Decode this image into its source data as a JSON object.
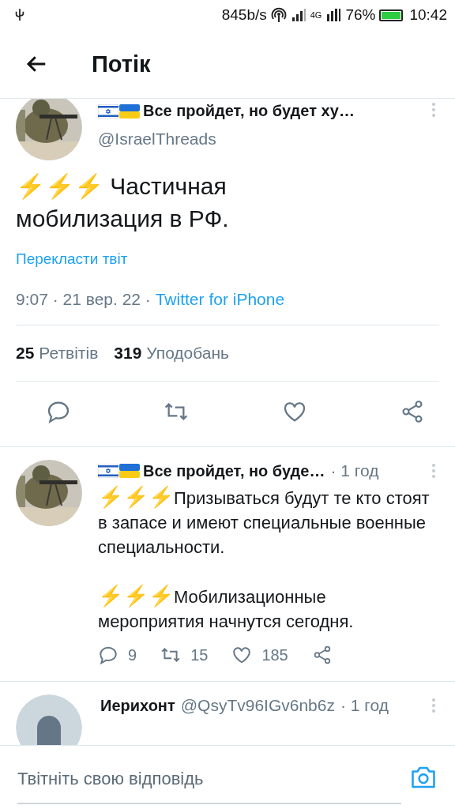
{
  "status_bar": {
    "speed": "845b/s",
    "network": "4G",
    "battery": "76%",
    "time": "10:42"
  },
  "header": {
    "title": "Потік"
  },
  "tweet": {
    "name": "Все пройдет, но будет ху…",
    "handle": "@IsraelThreads",
    "text": "Частичная мобилизация в РФ.",
    "bolts": "⚡⚡⚡",
    "translate": "Перекласти твіт",
    "time": "9:07 · 21 вер. 22 · ",
    "source": "Twitter for iPhone",
    "retweets": "25",
    "retweets_label": "Ретвітів",
    "likes": "319",
    "likes_label": "Уподобань"
  },
  "replies": [
    {
      "kind": "picture",
      "name": "Все пройдет, но буде…",
      "time": "· 1 год",
      "paragraphs": [
        {
          "bolts": "⚡⚡⚡",
          "text": "Призываться будут те кто стоят в запасе и имеют специальные военные специальности."
        },
        {
          "bolts": "⚡⚡⚡",
          "text": "Мобилизационные мероприятия начнутся сегодня."
        }
      ],
      "replies": "9",
      "retweets": "15",
      "likes": "185"
    },
    {
      "kind": "default",
      "name": "Иерихонт",
      "handle": "@QsyTv96IGv6nb6z",
      "time": "· 1 год"
    }
  ],
  "reply_bar": {
    "placeholder": "Твітніть свою відповідь"
  }
}
